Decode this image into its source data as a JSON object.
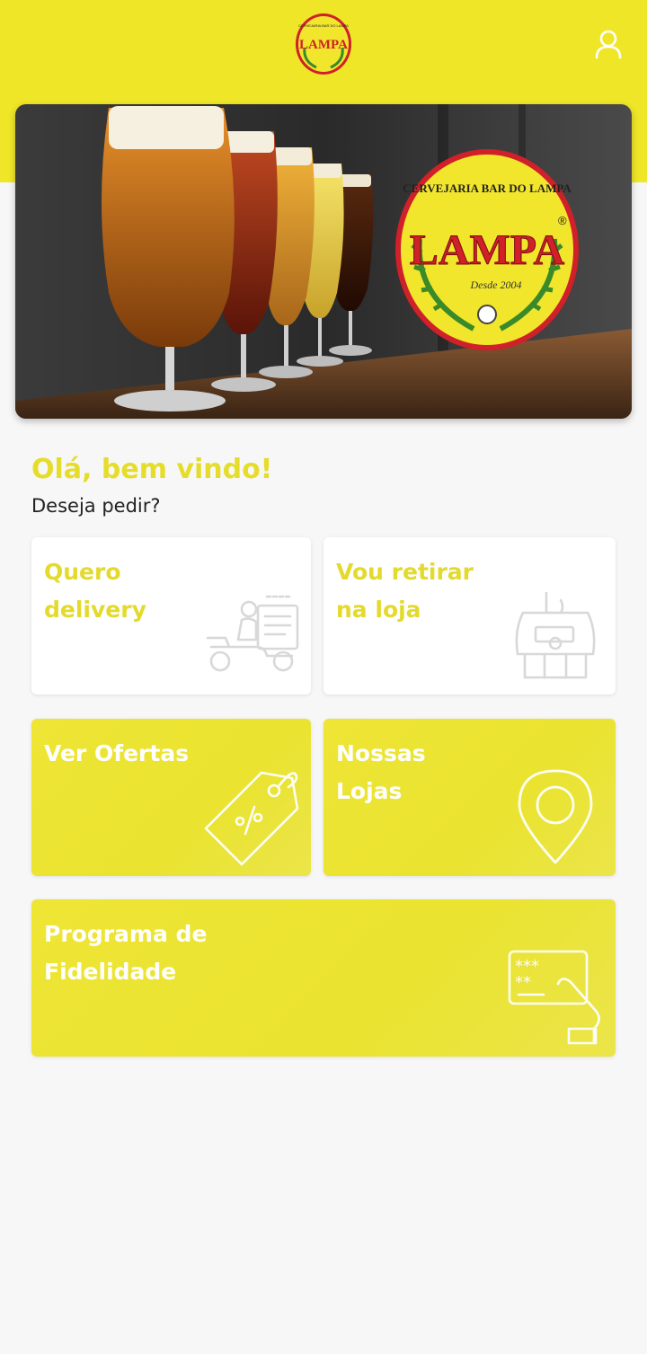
{
  "header": {
    "logo_text": "LAMPA",
    "logo_ring_text": "CERVEJARIA BAR DO LAMPA",
    "user_icon": "user-icon"
  },
  "banner": {
    "brand_ring_text": "CERVEJARIA BAR DO LAMPA",
    "brand_name": "LAMPA",
    "brand_since": "Desde 2004",
    "registered": "®"
  },
  "greeting": {
    "title": "Olá, bem vindo!",
    "subtitle": "Deseja pedir?"
  },
  "cards": {
    "delivery": {
      "line1": "Quero",
      "line2": "delivery",
      "icon": "delivery-scooter-icon"
    },
    "pickup": {
      "line1": "Vou retirar",
      "line2": "na loja",
      "icon": "store-pickup-icon"
    },
    "offers": {
      "line1": "Ver Ofertas",
      "icon": "price-tag-icon"
    },
    "stores": {
      "line1": "Nossas",
      "line2": "Lojas",
      "icon": "location-pin-icon"
    },
    "loyalty": {
      "line1": "Programa de",
      "line2": "Fidelidade",
      "icon": "loyalty-card-icon"
    }
  },
  "colors": {
    "brand_yellow": "#efe628",
    "accent_text": "#e3da2c",
    "logo_red": "#d0202a",
    "background": "#f7f7f7"
  }
}
